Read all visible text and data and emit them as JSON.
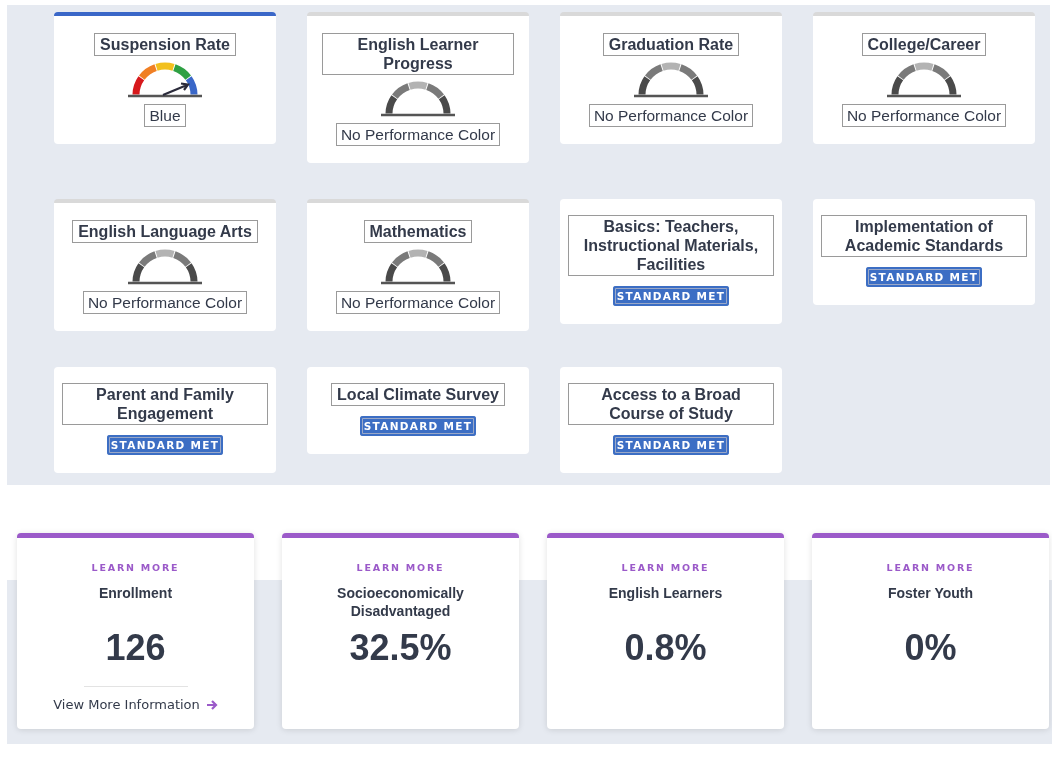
{
  "indicators": [
    {
      "kind": "gauge",
      "title": "Suspension Rate",
      "performance_color": true,
      "status": "Blue"
    },
    {
      "kind": "gauge",
      "title": "English Learner Progress",
      "performance_color": false,
      "status": "No Performance Color"
    },
    {
      "kind": "gauge",
      "title": "Graduation Rate",
      "performance_color": false,
      "status": "No Performance Color"
    },
    {
      "kind": "gauge",
      "title": "College/Career",
      "performance_color": false,
      "status": "No Performance Color"
    },
    {
      "kind": "gauge",
      "title": "English Language Arts",
      "performance_color": false,
      "status": "No Performance Color"
    },
    {
      "kind": "gauge",
      "title": "Mathematics",
      "performance_color": false,
      "status": "No Performance Color"
    },
    {
      "kind": "standard",
      "title": "Basics: Teachers, Instructional Materials, Facilities",
      "badge": "STANDARD MET"
    },
    {
      "kind": "standard",
      "title": "Implementation of Academic Standards",
      "badge": "STANDARD MET"
    },
    {
      "kind": "standard",
      "title": "Parent and Family Engagement",
      "badge": "STANDARD MET"
    },
    {
      "kind": "standard",
      "title": "Local Climate Survey",
      "badge": "STANDARD MET"
    },
    {
      "kind": "standard",
      "title": "Access to a Broad Course of Study",
      "badge": "STANDARD MET"
    }
  ],
  "stats": [
    {
      "eyebrow": "LEARN MORE",
      "title": "Enrollment",
      "value": "126",
      "link": "View More Information"
    },
    {
      "eyebrow": "LEARN MORE",
      "title": "Socioeconomically Disadvantaged",
      "value": "32.5%"
    },
    {
      "eyebrow": "LEARN MORE",
      "title": "English Learners",
      "value": "0.8%"
    },
    {
      "eyebrow": "LEARN MORE",
      "title": "Foster Youth",
      "value": "0%"
    }
  ]
}
